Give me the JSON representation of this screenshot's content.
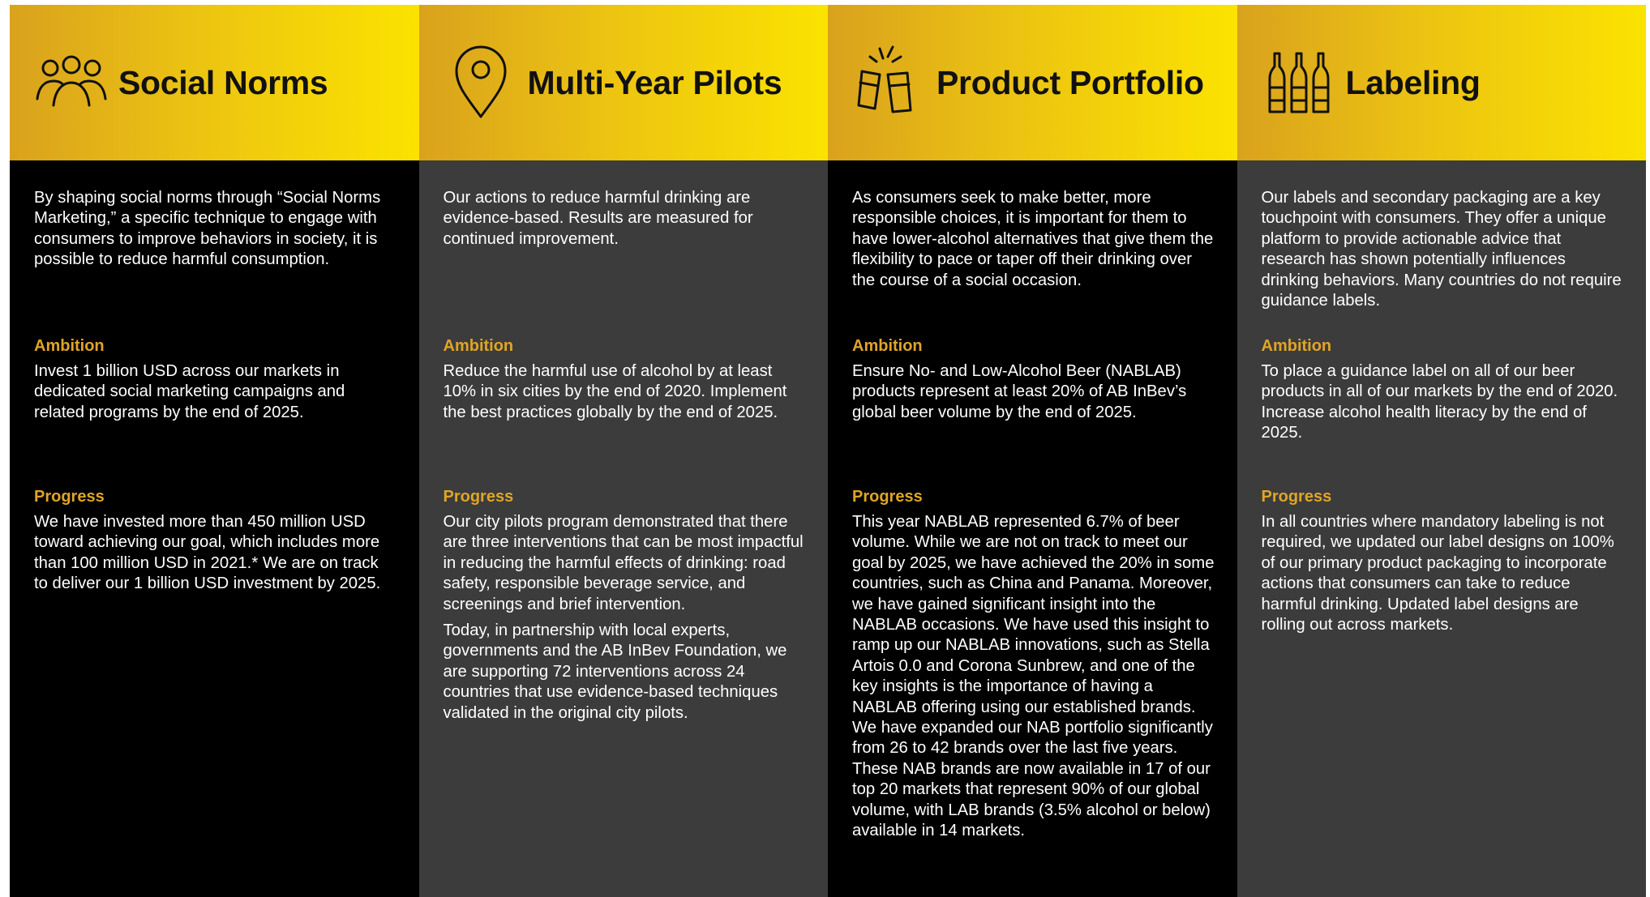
{
  "accent_color": "#e0a526",
  "header_gradient": [
    "#d9a21d",
    "#fbe300"
  ],
  "columns": [
    {
      "icon": "people-group-icon",
      "title": "Social Norms",
      "intro": "By shaping social norms through “Social Norms Marketing,” a specific technique to engage with consumers to improve behaviors in society, it is possible to reduce harmful consumption.",
      "ambition_label": "Ambition",
      "ambition": "Invest 1 billion USD across our markets in dedicated social marketing campaigns and related programs by the end of 2025.",
      "progress_label": "Progress",
      "progress": [
        "We have invested more than 450 million USD toward achieving our goal, which includes more than 100 million USD in 2021.*  We are on track to deliver our 1 billion USD investment by 2025."
      ]
    },
    {
      "icon": "map-pin-icon",
      "title": "Multi-Year Pilots",
      "intro": "Our actions to reduce harmful drinking are evidence-based. Results are measured for continued improvement.",
      "ambition_label": "Ambition",
      "ambition": "Reduce the harmful use of alcohol by at least 10% in six cities by the end of 2020. Implement the best practices globally by the end of 2025.",
      "progress_label": "Progress",
      "progress": [
        "Our city pilots program demonstrated that there are three interventions that can be most impactful in reducing the harmful effects of drinking: road safety, responsible beverage service, and screenings and brief intervention.",
        "Today, in partnership with local experts, governments and the AB InBev Foundation, we are supporting 72 interventions across 24 countries that use evidence-based techniques validated in the original city pilots."
      ]
    },
    {
      "icon": "cheers-glasses-icon",
      "title": "Product Portfolio",
      "intro": "As consumers seek to make better, more responsible choices, it is important for them to have lower-alcohol alternatives that give them the flexibility to pace or taper off their drinking over the course of a social occasion.",
      "ambition_label": "Ambition",
      "ambition": "Ensure No- and Low-Alcohol Beer (NABLAB) products represent at least 20% of AB InBev’s global beer volume by the end of 2025.",
      "progress_label": "Progress",
      "progress": [
        "This year NABLAB represented 6.7% of beer volume. While we are not on track to meet our goal by 2025, we have achieved the 20% in some countries, such as China and Panama. Moreover, we have gained significant insight into the NABLAB occasions.  We have used this insight to ramp up our NABLAB innovations, such as Stella Artois 0.0 and Corona Sunbrew, and one of the key insights is the importance of having a NABLAB offering using our established brands. We have expanded our NAB portfolio significantly from 26 to 42 brands over the last five years. These NAB brands are now available in 17 of our top 20 markets that represent 90% of our global volume, with LAB brands (3.5% alcohol or below) available in 14 markets."
      ]
    },
    {
      "icon": "beer-bottles-icon",
      "title": "Labeling",
      "intro": "Our labels and secondary packaging are a key touchpoint with consumers. They offer a unique platform to provide actionable advice that research has shown potentially influences drinking behaviors. Many countries do not require guidance labels.",
      "ambition_label": "Ambition",
      "ambition": "To place a guidance label on all of our beer products in all of our markets by the end of 2020. Increase alcohol health literacy by the end of 2025.",
      "progress_label": "Progress",
      "progress": [
        "In all countries where mandatory labeling is not required, we updated our label designs on 100% of our primary product packaging to incorporate actions that consumers can take to reduce harmful drinking. Updated label designs are rolling out across markets."
      ]
    }
  ]
}
